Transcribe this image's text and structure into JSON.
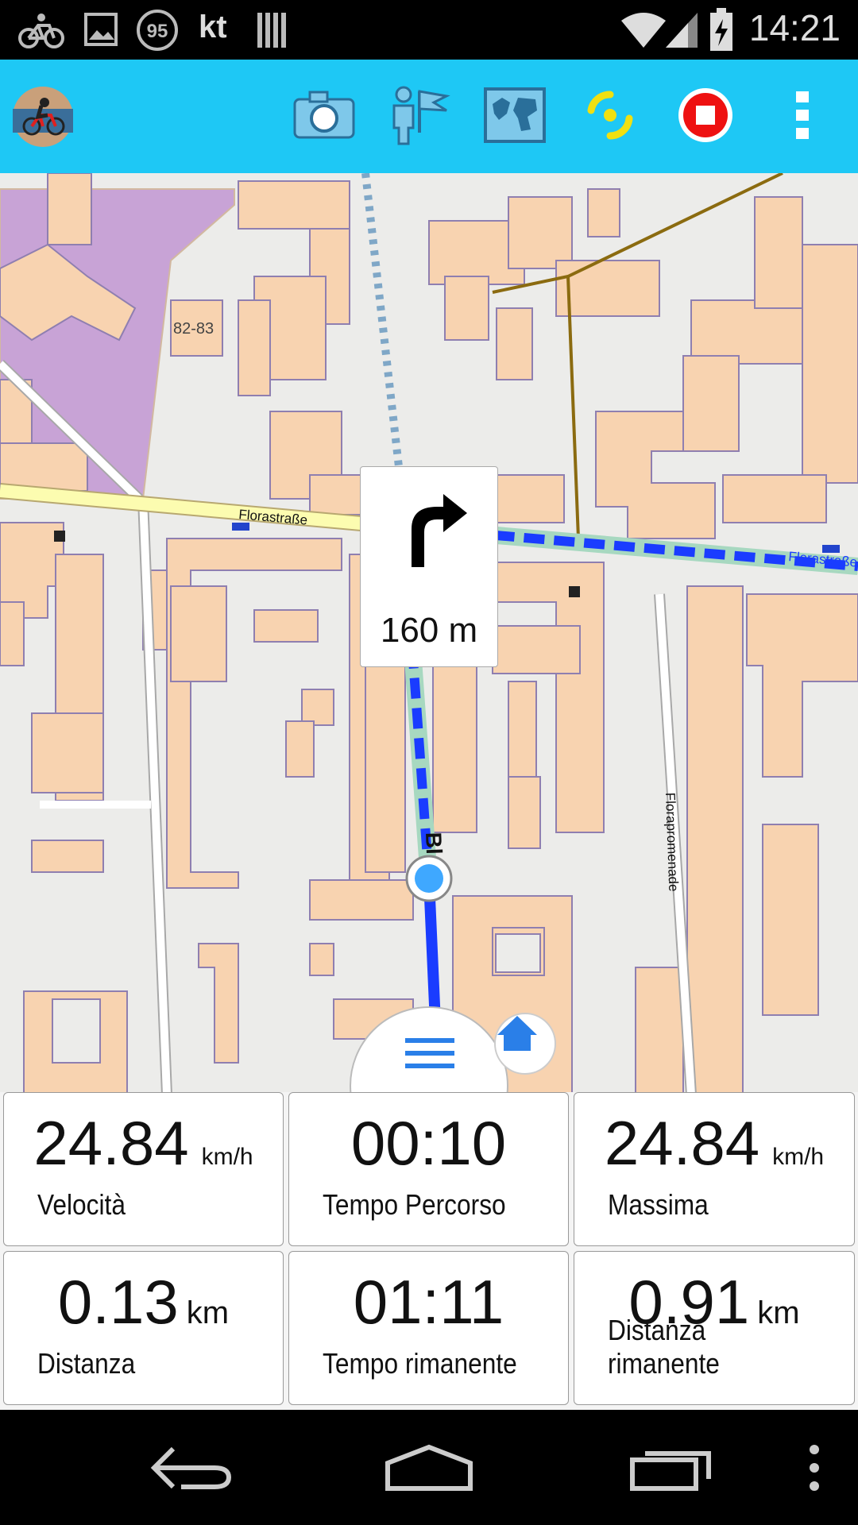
{
  "status_bar": {
    "time": "14:21",
    "notification_badge": "95",
    "carrier_text": "kt",
    "icons": [
      "bike-icon",
      "image-icon",
      "badge-icon",
      "barcode-icon",
      "wifi-icon",
      "signal-icon",
      "battery-charging-icon"
    ]
  },
  "toolbar": {
    "avatar": "cyclist-avatar",
    "buttons": [
      "camera-icon",
      "waypoint-flag-icon",
      "map-icon",
      "gps-icon",
      "stop-recording-icon",
      "overflow-menu-icon"
    ],
    "accent_color": "#1ec8f5"
  },
  "map": {
    "turn_instruction": {
      "icon": "turn-right-icon",
      "distance": "160 m"
    },
    "street_labels": {
      "florastrasse": "Florastraße",
      "florastrasse_right": "Florastraße",
      "florapromenade": "Florapromenade",
      "current_street_fragment": "Bl"
    },
    "house_number": "82-83",
    "route_color": "#1a3cff"
  },
  "stats": [
    {
      "value": "24.84",
      "unit": "km/h",
      "label": "Velocità"
    },
    {
      "value": "00:10",
      "unit": "",
      "label": "Tempo Percorso"
    },
    {
      "value": "24.84",
      "unit": "km/h",
      "label": "Massima"
    },
    {
      "value": "0.13",
      "unit": "km",
      "label": "Distanza"
    },
    {
      "value": "01:11",
      "unit": "",
      "label": "Tempo rimanente"
    },
    {
      "value": "0.91",
      "unit": "km",
      "label": "Distanza rimanente"
    }
  ],
  "nav_bar": {
    "buttons": [
      "back-icon",
      "home-icon",
      "recent-apps-icon",
      "overflow-icon"
    ]
  }
}
